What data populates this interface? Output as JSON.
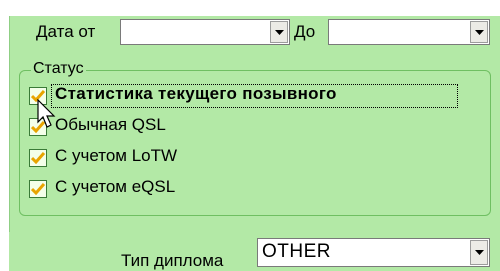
{
  "filters": {
    "date_from_label": "Дата от",
    "date_from_value": "",
    "date_to_label": "До",
    "date_to_value": ""
  },
  "status_group": {
    "title": "Статус",
    "options": [
      {
        "label": "Статистика текущего позывного",
        "checked": true,
        "focused": true
      },
      {
        "label": "Обычная QSL",
        "checked": true
      },
      {
        "label": "С учетом LoTW",
        "checked": true
      },
      {
        "label": "С учетом eQSL",
        "checked": true
      }
    ]
  },
  "diploma": {
    "label": "Тип диплома",
    "value": "OTHER"
  },
  "icons": {
    "dropdown": "chevron-down-icon",
    "check": "checkmark-icon",
    "cursor": "mouse-pointer-icon"
  },
  "colors": {
    "panel_bg": "#b3e9a6",
    "check_color": "#e8a400",
    "group_border": "#6fbf62"
  }
}
